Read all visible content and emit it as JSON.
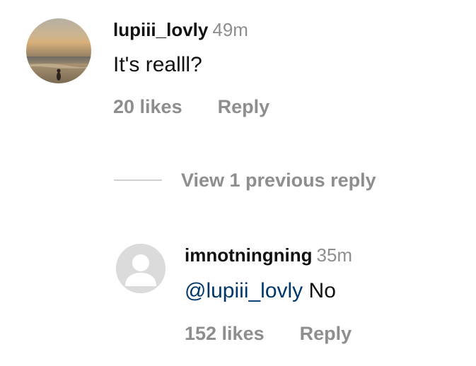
{
  "comment": {
    "username": "lupiii_lovly",
    "time": "49m",
    "text": "It's realll?",
    "likes": "20 likes",
    "reply_label": "Reply"
  },
  "view_previous": "View 1 previous reply",
  "reply": {
    "username": "imnotningning",
    "time": "35m",
    "mention": "@lupiii_lovly",
    "text": "No",
    "likes": "152 likes",
    "reply_label": "Reply"
  },
  "colors": {
    "secondary_text": "#8e8e8e",
    "mention": "#00376b",
    "primary_text": "#111111",
    "default_avatar_bg": "#dbdbdb"
  },
  "icons": {
    "main_avatar": "beach-sunset-photo",
    "reply_avatar": "default-user-icon"
  }
}
